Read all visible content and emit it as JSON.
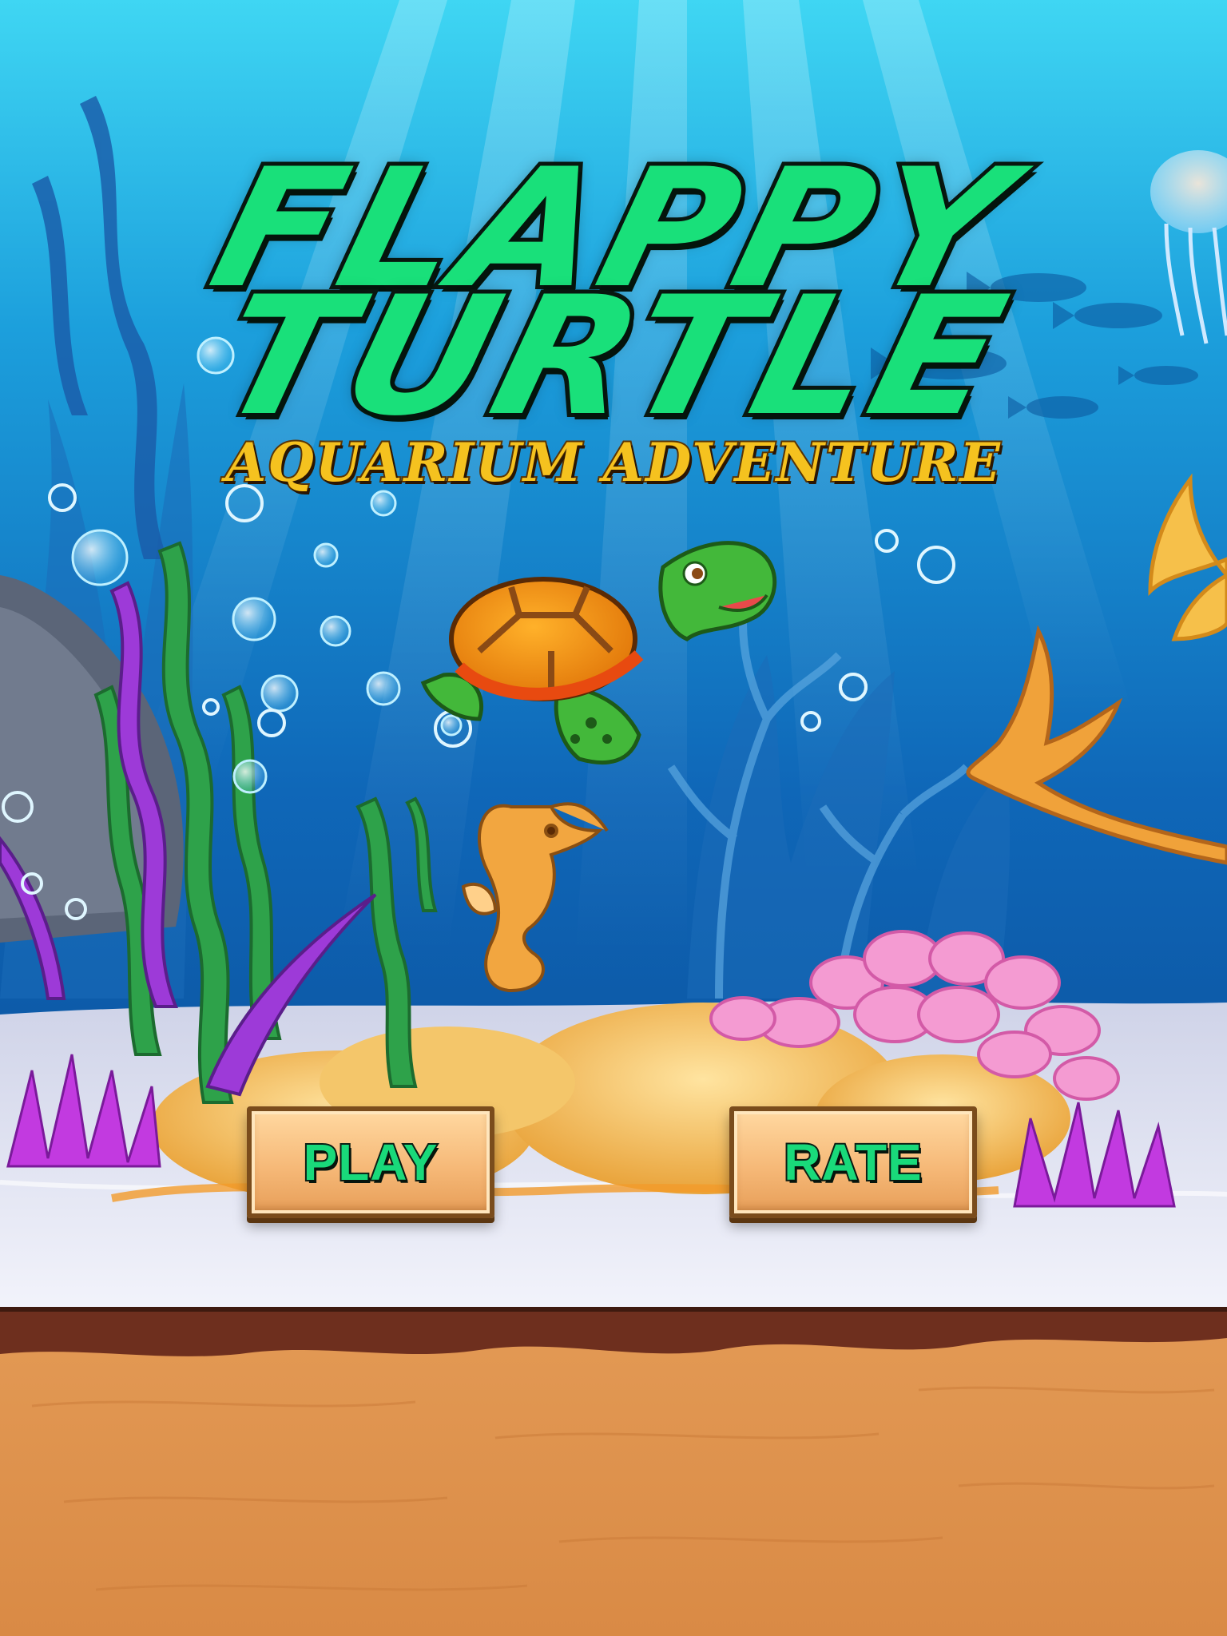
{
  "game": {
    "title_line1": "FLAPPY",
    "title_line2": "TURTLE",
    "subtitle": "AQUARIUM ADVENTURE"
  },
  "menu": {
    "play_label": "PLAY",
    "rate_label": "RATE"
  },
  "colors": {
    "title_green": "#19e07a",
    "subtitle_gold": "#f5c21f",
    "button_tan": "#f6b978",
    "water_top": "#3ad0f0",
    "water_deep": "#0a4f9a",
    "sand_floor": "#e8a05a"
  },
  "characters": [
    "turtle",
    "seahorse",
    "jellyfish",
    "starfish"
  ]
}
